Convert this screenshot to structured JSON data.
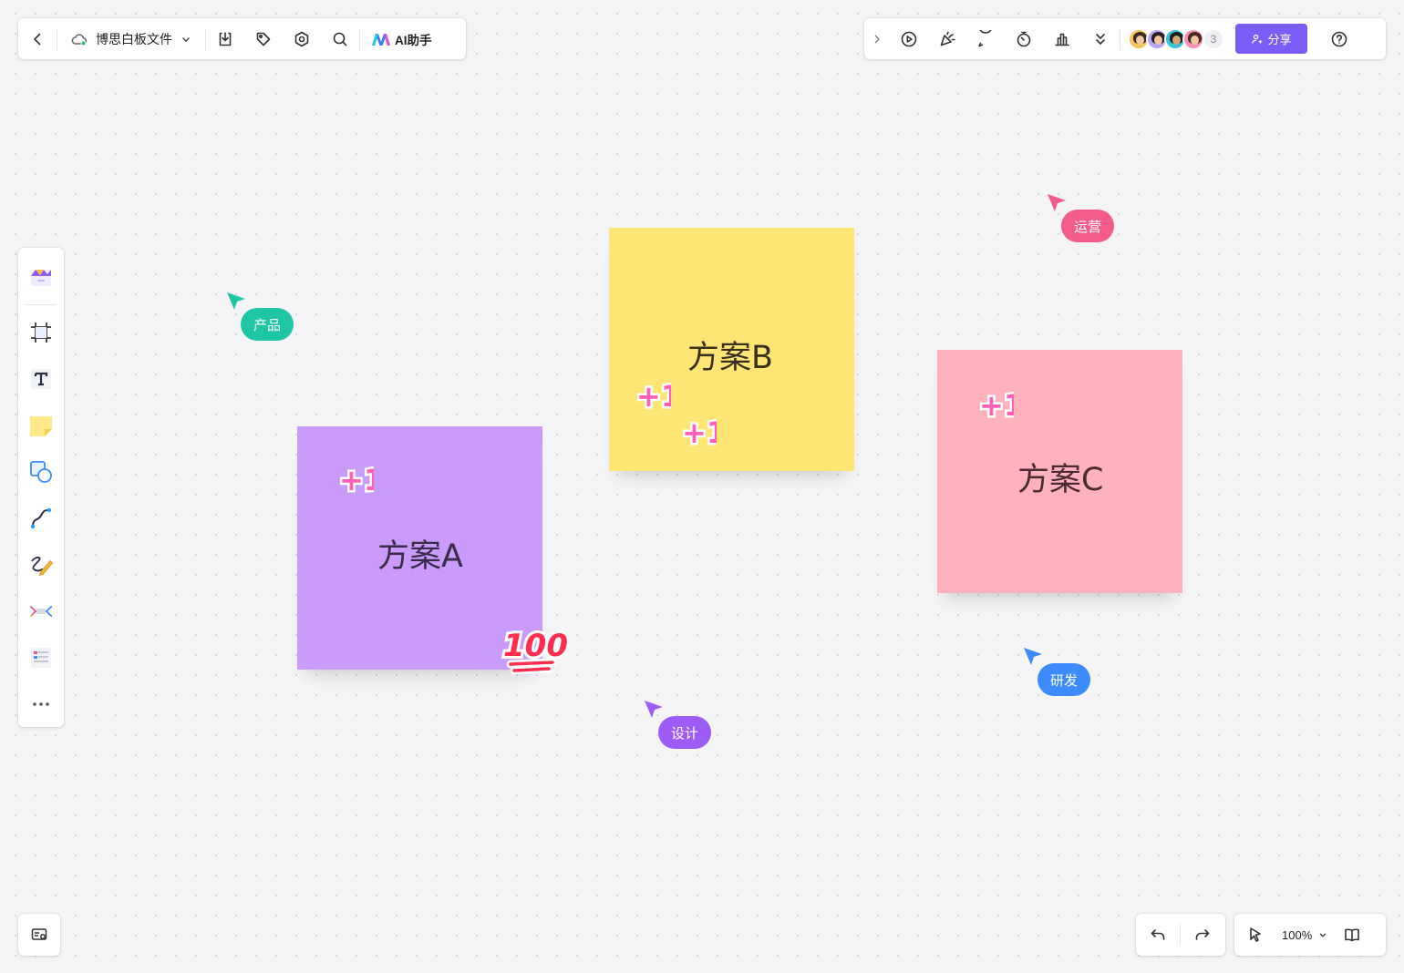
{
  "header": {
    "doc_title": "博思白板文件",
    "ai_label": "AI助手"
  },
  "topbar_right": {
    "avatar_count": "3",
    "share_label": "分享"
  },
  "left_toolbar": {
    "tools": [
      "template-icon",
      "frame-icon",
      "text-icon",
      "sticky-note-icon",
      "shape-icon",
      "connector-icon",
      "pen-icon",
      "mindmap-icon",
      "table-icon",
      "more-icon"
    ]
  },
  "bottom": {
    "zoom_value": "100%"
  },
  "stickies": [
    {
      "label": "方案A",
      "color": "#ca9bfa"
    },
    {
      "label": "方案B",
      "color": "#ffe574"
    },
    {
      "label": "方案C",
      "color": "#ffb1bd"
    }
  ],
  "stickers": {
    "plus_one": "+1",
    "hundred": "100"
  },
  "cursors": [
    {
      "label": "产品",
      "color": "#1fc6a6"
    },
    {
      "label": "运营",
      "color": "#f35c8a"
    },
    {
      "label": "研发",
      "color": "#3d8bfd"
    },
    {
      "label": "设计",
      "color": "#9d5cf6"
    }
  ],
  "colors": {
    "accent": "#7b5cf6",
    "canvas": "#f5f5f7"
  }
}
